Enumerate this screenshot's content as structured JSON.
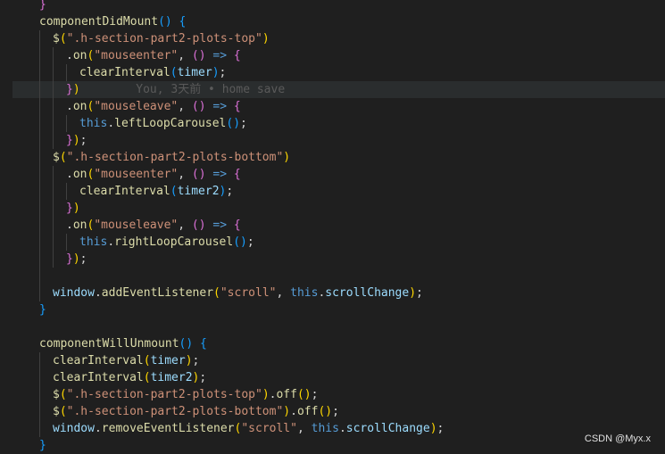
{
  "editor": {
    "lines": [
      {
        "tokens": [
          {
            "c": "br2",
            "t": "}"
          }
        ],
        "indent": 1
      },
      {
        "tokens": [
          {
            "c": "fn",
            "t": "componentDidMount"
          },
          {
            "c": "br3",
            "t": "()"
          },
          {
            "c": "punc",
            "t": " "
          },
          {
            "c": "br3",
            "t": "{"
          }
        ],
        "indent": 1
      },
      {
        "tokens": [
          {
            "c": "fn",
            "t": "$"
          },
          {
            "c": "br1",
            "t": "("
          },
          {
            "c": "str",
            "t": "\".h-section-part2-plots-top\""
          },
          {
            "c": "br1",
            "t": ")"
          }
        ],
        "indent": 2
      },
      {
        "tokens": [
          {
            "c": "punc",
            "t": "."
          },
          {
            "c": "fn",
            "t": "on"
          },
          {
            "c": "br1",
            "t": "("
          },
          {
            "c": "str",
            "t": "\"mouseenter\""
          },
          {
            "c": "punc",
            "t": ", "
          },
          {
            "c": "br2",
            "t": "()"
          },
          {
            "c": "punc",
            "t": " "
          },
          {
            "c": "kw",
            "t": "=>"
          },
          {
            "c": "punc",
            "t": " "
          },
          {
            "c": "br2",
            "t": "{"
          }
        ],
        "indent": 3
      },
      {
        "tokens": [
          {
            "c": "fn",
            "t": "clearInterval"
          },
          {
            "c": "br3",
            "t": "("
          },
          {
            "c": "var",
            "t": "timer"
          },
          {
            "c": "br3",
            "t": ")"
          },
          {
            "c": "punc",
            "t": ";"
          }
        ],
        "indent": 4
      },
      {
        "tokens": [
          {
            "c": "br2",
            "t": "}"
          },
          {
            "c": "br1",
            "t": ")"
          },
          {
            "c": "ghost",
            "t": "        You, 3天前 • home save"
          }
        ],
        "indent": 3,
        "highlight": true
      },
      {
        "tokens": [
          {
            "c": "punc",
            "t": "."
          },
          {
            "c": "fn",
            "t": "on"
          },
          {
            "c": "br1",
            "t": "("
          },
          {
            "c": "str",
            "t": "\"mouseleave\""
          },
          {
            "c": "punc",
            "t": ", "
          },
          {
            "c": "br2",
            "t": "()"
          },
          {
            "c": "punc",
            "t": " "
          },
          {
            "c": "kw",
            "t": "=>"
          },
          {
            "c": "punc",
            "t": " "
          },
          {
            "c": "br2",
            "t": "{"
          }
        ],
        "indent": 3
      },
      {
        "tokens": [
          {
            "c": "kw",
            "t": "this"
          },
          {
            "c": "punc",
            "t": "."
          },
          {
            "c": "fn",
            "t": "leftLoopCarousel"
          },
          {
            "c": "br3",
            "t": "()"
          },
          {
            "c": "punc",
            "t": ";"
          }
        ],
        "indent": 4
      },
      {
        "tokens": [
          {
            "c": "br2",
            "t": "}"
          },
          {
            "c": "br1",
            "t": ")"
          },
          {
            "c": "punc",
            "t": ";"
          }
        ],
        "indent": 3
      },
      {
        "tokens": [
          {
            "c": "fn",
            "t": "$"
          },
          {
            "c": "br1",
            "t": "("
          },
          {
            "c": "str",
            "t": "\".h-section-part2-plots-bottom\""
          },
          {
            "c": "br1",
            "t": ")"
          }
        ],
        "indent": 2
      },
      {
        "tokens": [
          {
            "c": "punc",
            "t": "."
          },
          {
            "c": "fn",
            "t": "on"
          },
          {
            "c": "br1",
            "t": "("
          },
          {
            "c": "str",
            "t": "\"mouseenter\""
          },
          {
            "c": "punc",
            "t": ", "
          },
          {
            "c": "br2",
            "t": "()"
          },
          {
            "c": "punc",
            "t": " "
          },
          {
            "c": "kw",
            "t": "=>"
          },
          {
            "c": "punc",
            "t": " "
          },
          {
            "c": "br2",
            "t": "{"
          }
        ],
        "indent": 3
      },
      {
        "tokens": [
          {
            "c": "fn",
            "t": "clearInterval"
          },
          {
            "c": "br3",
            "t": "("
          },
          {
            "c": "var",
            "t": "timer2"
          },
          {
            "c": "br3",
            "t": ")"
          },
          {
            "c": "punc",
            "t": ";"
          }
        ],
        "indent": 4
      },
      {
        "tokens": [
          {
            "c": "br2",
            "t": "}"
          },
          {
            "c": "br1",
            "t": ")"
          }
        ],
        "indent": 3
      },
      {
        "tokens": [
          {
            "c": "punc",
            "t": "."
          },
          {
            "c": "fn",
            "t": "on"
          },
          {
            "c": "br1",
            "t": "("
          },
          {
            "c": "str",
            "t": "\"mouseleave\""
          },
          {
            "c": "punc",
            "t": ", "
          },
          {
            "c": "br2",
            "t": "()"
          },
          {
            "c": "punc",
            "t": " "
          },
          {
            "c": "kw",
            "t": "=>"
          },
          {
            "c": "punc",
            "t": " "
          },
          {
            "c": "br2",
            "t": "{"
          }
        ],
        "indent": 3
      },
      {
        "tokens": [
          {
            "c": "kw",
            "t": "this"
          },
          {
            "c": "punc",
            "t": "."
          },
          {
            "c": "fn",
            "t": "rightLoopCarousel"
          },
          {
            "c": "br3",
            "t": "()"
          },
          {
            "c": "punc",
            "t": ";"
          }
        ],
        "indent": 4
      },
      {
        "tokens": [
          {
            "c": "br2",
            "t": "}"
          },
          {
            "c": "br1",
            "t": ")"
          },
          {
            "c": "punc",
            "t": ";"
          }
        ],
        "indent": 3
      },
      {
        "tokens": [],
        "indent": 2
      },
      {
        "tokens": [
          {
            "c": "var",
            "t": "window"
          },
          {
            "c": "punc",
            "t": "."
          },
          {
            "c": "fn",
            "t": "addEventListener"
          },
          {
            "c": "br1",
            "t": "("
          },
          {
            "c": "str",
            "t": "\"scroll\""
          },
          {
            "c": "punc",
            "t": ", "
          },
          {
            "c": "kw",
            "t": "this"
          },
          {
            "c": "punc",
            "t": "."
          },
          {
            "c": "var",
            "t": "scrollChange"
          },
          {
            "c": "br1",
            "t": ")"
          },
          {
            "c": "punc",
            "t": ";"
          }
        ],
        "indent": 2
      },
      {
        "tokens": [
          {
            "c": "br3",
            "t": "}"
          }
        ],
        "indent": 1
      },
      {
        "tokens": [],
        "indent": 1
      },
      {
        "tokens": [
          {
            "c": "fn",
            "t": "componentWillUnmount"
          },
          {
            "c": "br3",
            "t": "()"
          },
          {
            "c": "punc",
            "t": " "
          },
          {
            "c": "br3",
            "t": "{"
          }
        ],
        "indent": 1
      },
      {
        "tokens": [
          {
            "c": "fn",
            "t": "clearInterval"
          },
          {
            "c": "br1",
            "t": "("
          },
          {
            "c": "var",
            "t": "timer"
          },
          {
            "c": "br1",
            "t": ")"
          },
          {
            "c": "punc",
            "t": ";"
          }
        ],
        "indent": 2
      },
      {
        "tokens": [
          {
            "c": "fn",
            "t": "clearInterval"
          },
          {
            "c": "br1",
            "t": "("
          },
          {
            "c": "var",
            "t": "timer2"
          },
          {
            "c": "br1",
            "t": ")"
          },
          {
            "c": "punc",
            "t": ";"
          }
        ],
        "indent": 2
      },
      {
        "tokens": [
          {
            "c": "fn",
            "t": "$"
          },
          {
            "c": "br1",
            "t": "("
          },
          {
            "c": "str",
            "t": "\".h-section-part2-plots-top\""
          },
          {
            "c": "br1",
            "t": ")"
          },
          {
            "c": "punc",
            "t": "."
          },
          {
            "c": "fn",
            "t": "off"
          },
          {
            "c": "br1",
            "t": "()"
          },
          {
            "c": "punc",
            "t": ";"
          }
        ],
        "indent": 2
      },
      {
        "tokens": [
          {
            "c": "fn",
            "t": "$"
          },
          {
            "c": "br1",
            "t": "("
          },
          {
            "c": "str",
            "t": "\".h-section-part2-plots-bottom\""
          },
          {
            "c": "br1",
            "t": ")"
          },
          {
            "c": "punc",
            "t": "."
          },
          {
            "c": "fn",
            "t": "off"
          },
          {
            "c": "br1",
            "t": "()"
          },
          {
            "c": "punc",
            "t": ";"
          }
        ],
        "indent": 2
      },
      {
        "tokens": [
          {
            "c": "var",
            "t": "window"
          },
          {
            "c": "punc",
            "t": "."
          },
          {
            "c": "fn",
            "t": "removeEventListener"
          },
          {
            "c": "br1",
            "t": "("
          },
          {
            "c": "str",
            "t": "\"scroll\""
          },
          {
            "c": "punc",
            "t": ", "
          },
          {
            "c": "kw",
            "t": "this"
          },
          {
            "c": "punc",
            "t": "."
          },
          {
            "c": "var",
            "t": "scrollChange"
          },
          {
            "c": "br1",
            "t": ")"
          },
          {
            "c": "punc",
            "t": ";"
          }
        ],
        "indent": 2
      },
      {
        "tokens": [
          {
            "c": "br3",
            "t": "}"
          }
        ],
        "indent": 1
      }
    ]
  },
  "watermark": "CSDN @Myx.x"
}
